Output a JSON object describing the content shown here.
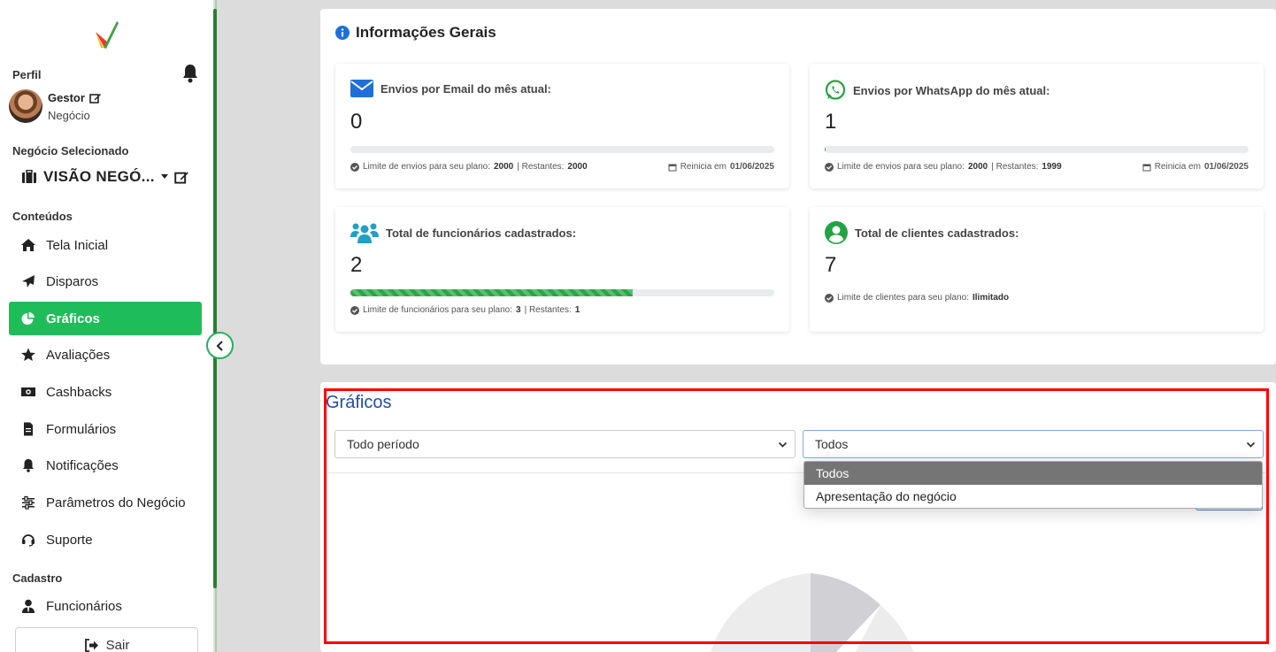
{
  "sidebar": {
    "profile_label": "Perfil",
    "user_name": "Gestor",
    "user_role": "Negócio",
    "selected_business_label": "Negócio Selecionado",
    "selected_business": "VISÃO NEGÓ...",
    "contents_label": "Conteúdos",
    "register_label": "Cadastro",
    "items": [
      {
        "label": "Tela Inicial",
        "icon": "home-icon"
      },
      {
        "label": "Disparos",
        "icon": "paper-plane-icon"
      },
      {
        "label": "Gráficos",
        "icon": "pie-chart-icon",
        "active": true
      },
      {
        "label": "Avaliações",
        "icon": "star-icon"
      },
      {
        "label": "Cashbacks",
        "icon": "money-bill-icon"
      },
      {
        "label": "Formulários",
        "icon": "file-icon"
      },
      {
        "label": "Notificações",
        "icon": "bell-icon"
      },
      {
        "label": "Parâmetros do Negócio",
        "icon": "sliders-icon"
      },
      {
        "label": "Suporte",
        "icon": "headset-icon"
      }
    ],
    "register_items": [
      {
        "label": "Funcionários",
        "icon": "user-tie-icon"
      }
    ],
    "logout_label": "Sair",
    "accent_color": "#1fbd5a"
  },
  "info": {
    "title": "Informações Gerais",
    "email": {
      "title": "Envios por Email do mês atual:",
      "value": "0",
      "progress": 0,
      "limit_label": "Limite de envios para seu plano:",
      "limit": "2000",
      "remaining_label": "| Restantes:",
      "remaining": "2000",
      "reset_label": "Reinicia em",
      "reset_date": "01/06/2025"
    },
    "whatsapp": {
      "title": "Envios por WhatsApp do mês atual:",
      "value": "1",
      "progress": 0.0005,
      "limit_label": "Limite de envios para seu plano:",
      "limit": "2000",
      "remaining_label": "| Restantes:",
      "remaining": "1999",
      "reset_label": "Reinicia em",
      "reset_date": "01/06/2025"
    },
    "employees": {
      "title": "Total de funcionários cadastrados:",
      "value": "2",
      "progress": 0.667,
      "limit_label": "Limite de funcionários para seu plano:",
      "limit": "3",
      "remaining_label": "| Restantes:",
      "remaining": "1"
    },
    "clients": {
      "title": "Total de clientes cadastrados:",
      "value": "7",
      "limit_label": "Limite de clientes para seu plano:",
      "limit": "Ilimitado"
    }
  },
  "graphs": {
    "title": "Gráficos",
    "period_select": "Todo período",
    "type_select": "Todos",
    "dropdown_options": [
      "Todos",
      "Apresentação do negócio"
    ]
  }
}
